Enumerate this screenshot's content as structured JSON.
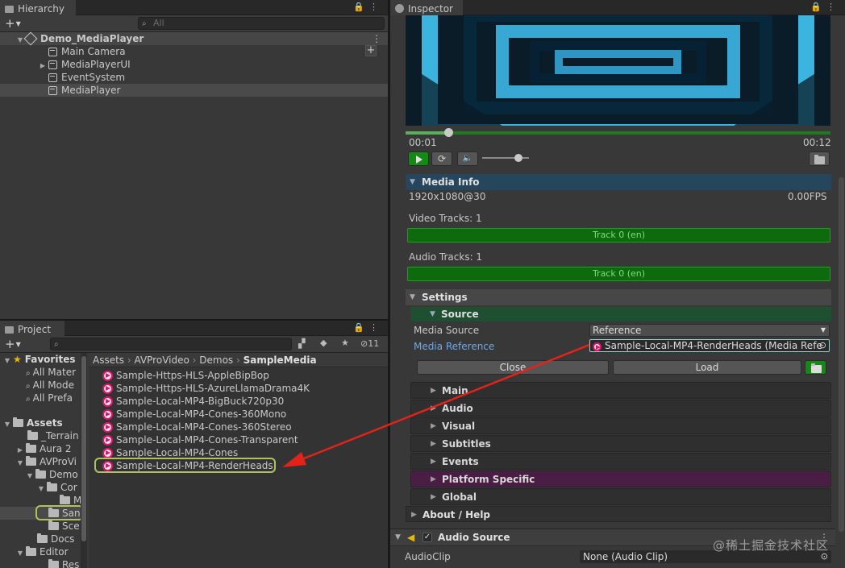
{
  "hierarchy": {
    "tab": "Hierarchy",
    "search_placeholder": "All",
    "scene": "Demo_MediaPlayer",
    "objects": [
      "Main Camera",
      "MediaPlayerUI",
      "EventSystem",
      "MediaPlayer"
    ]
  },
  "project": {
    "tab": "Project",
    "hidden_count": "11",
    "favorites": {
      "label": "Favorites",
      "items": [
        "All Mater",
        "All Mode",
        "All Prefa"
      ]
    },
    "tree": {
      "assets": "Assets",
      "items": [
        "_Terrain",
        "Aura 2",
        "AVProVi",
        "Demo",
        "Cor",
        "M",
        "San",
        "Sce",
        "Docs",
        "Editor",
        "Res"
      ]
    },
    "breadcrumb": [
      "Assets",
      "AVProVideo",
      "Demos",
      "SampleMedia"
    ],
    "files": [
      "Sample-Https-HLS-AppleBipBop",
      "Sample-Https-HLS-AzureLlamaDrama4K",
      "Sample-Local-MP4-BigBuck720p30",
      "Sample-Local-MP4-Cones-360Mono",
      "Sample-Local-MP4-Cones-360Stereo",
      "Sample-Local-MP4-Cones-Transparent",
      "Sample-Local-MP4-Cones",
      "Sample-Local-MP4-RenderHeads"
    ]
  },
  "inspector": {
    "tab": "Inspector",
    "time_current": "00:01",
    "time_total": "00:12",
    "progress": 0.1,
    "volume": 0.78,
    "media_info": {
      "title": "Media Info",
      "resolution": "1920x1080@30",
      "fps": "0.00FPS",
      "video_tracks_label": "Video Tracks: 1",
      "video_track": "Track 0 (en)",
      "audio_tracks_label": "Audio Tracks: 1",
      "audio_track": "Track 0 (en)"
    },
    "settings": {
      "title": "Settings",
      "source_title": "Source",
      "media_source_label": "Media Source",
      "media_source_value": "Reference",
      "media_reference_label": "Media Reference",
      "media_reference_value": "Sample-Local-MP4-RenderHeads (Media Refe",
      "close_label": "Close",
      "load_label": "Load",
      "sections": [
        "Main",
        "Audio",
        "Visual",
        "Subtitles",
        "Events",
        "Platform Specific",
        "Global"
      ]
    },
    "about": "About / Help",
    "audio_source": {
      "title": "Audio Source",
      "clip_label": "AudioClip",
      "clip_value": "None (Audio Clip)"
    }
  },
  "watermark": "@稀土掘金技术社区",
  "colors": {
    "accent_green": "#1aa31a",
    "platform_purple": "#4a1d44",
    "highlight": "#b2c25b",
    "arrow": "#e2231a"
  }
}
